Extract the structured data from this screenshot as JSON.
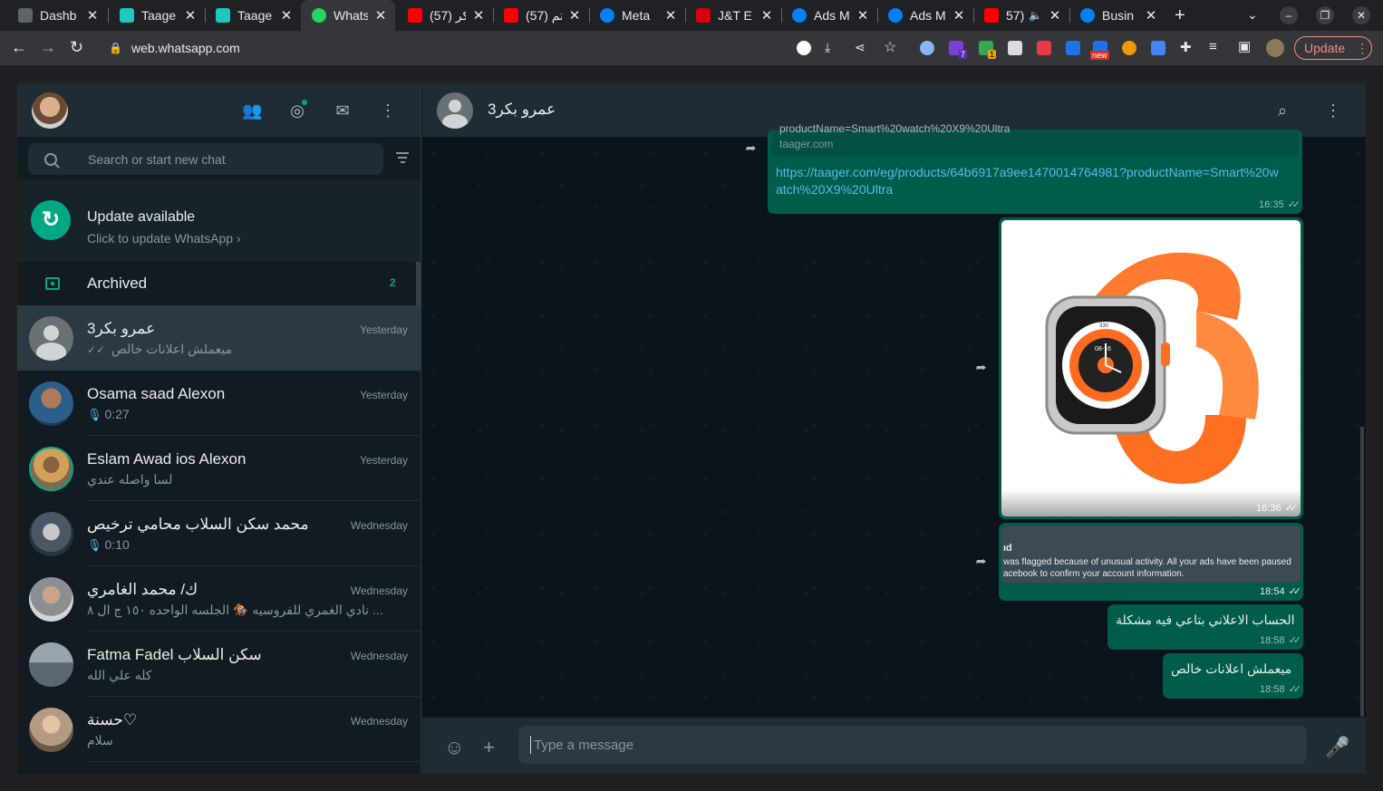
{
  "browser": {
    "tabs": [
      {
        "title": "Dashb",
        "favicon_color": "#5f6368"
      },
      {
        "title": "Taage",
        "favicon_color": "#1ec7c0"
      },
      {
        "title": "Taage",
        "favicon_color": "#1ec7c0"
      },
      {
        "title": "Whats",
        "favicon_color": "#25d366"
      },
      {
        "title": "(57) كر",
        "favicon_color": "#ff0000"
      },
      {
        "title": "(57) تم",
        "favicon_color": "#ff0000"
      },
      {
        "title": "Meta",
        "favicon_color": "#0081fb"
      },
      {
        "title": "J&T E",
        "favicon_color": "#d7000f"
      },
      {
        "title": "Ads M",
        "favicon_color": "#0081fb"
      },
      {
        "title": "Ads M",
        "favicon_color": "#0081fb"
      },
      {
        "title": "57)",
        "favicon_color": "#ff0000"
      },
      {
        "title": "Busin",
        "favicon_color": "#0081fb"
      }
    ],
    "new_tab_label": "+",
    "url": "web.whatsapp.com",
    "update_label": "Update",
    "ext_badges": {
      "purple": "7",
      "green": "1",
      "new": "new"
    }
  },
  "sidebar": {
    "search_placeholder": "Search or start new chat",
    "update_banner": {
      "title": "Update available",
      "subtitle": "Click to update WhatsApp ›"
    },
    "archived": {
      "label": "Archived",
      "count": "2"
    },
    "chats": [
      {
        "name": "عمرو بكر3",
        "time": "Yesterday",
        "preview": "ميعملش اعلانات خالص",
        "prefix": "ticks",
        "avatar_color": "#6a7175"
      },
      {
        "name": "Osama saad Alexon",
        "time": "Yesterday",
        "preview": "0:27",
        "prefix": "mic",
        "avatar_color": "#2b5e8a"
      },
      {
        "name": "Eslam Awad ios Alexon",
        "time": "Yesterday",
        "preview": "لسا واصله عندي",
        "prefix": "",
        "avatar_color": "#7d6b52"
      },
      {
        "name": "محمد سكن السلاب محامي ترخيص",
        "time": "Wednesday",
        "preview": "0:10",
        "prefix": "mic",
        "avatar_color": "#4a5866"
      },
      {
        "name": "ك/ محمد الغامري",
        "time": "Wednesday",
        "preview": "نادي الغمري للفروسيه 🏇 الجلسه الواحده ١٥٠ ج ال ٨ ...",
        "prefix": "",
        "avatar_color": "#8a8f94"
      },
      {
        "name": "Fatma Fadel سكن السلاب",
        "time": "Wednesday",
        "preview": "كله علي الله",
        "prefix": "",
        "avatar_color": "#5b6670"
      },
      {
        "name": "حسنة♡",
        "time": "Wednesday",
        "preview": "سلام",
        "prefix": "",
        "avatar_color": "#b49a82"
      }
    ]
  },
  "conversation": {
    "contact_name": "عمرو بكر3",
    "messages": {
      "link": {
        "preview_title": "productName=Smart%20watch%20X9%20Ultra",
        "preview_domain": "taager.com",
        "text": "https://taager.com/eg/products/64b6917a9ee1470014764981?productName=Smart%20watch%20X9%20Ultra",
        "time": "16:35"
      },
      "image": {
        "time": "16:36",
        "watch_time": "08-16",
        "bezel_330": "330"
      },
      "screenshot": {
        "line1": "ıd",
        "line2": "was flagged because of unusual activity. All your ads have been paused",
        "line3": "acebook to confirm your account information.",
        "time": "18:54"
      },
      "text1": {
        "text": "الحساب الاعلاني بتاعي فيه مشكلة",
        "time": "18:58"
      },
      "text2": {
        "text": "ميعملش اعلانات خالص",
        "time": "18:58"
      }
    },
    "input_placeholder": "Type a message"
  }
}
